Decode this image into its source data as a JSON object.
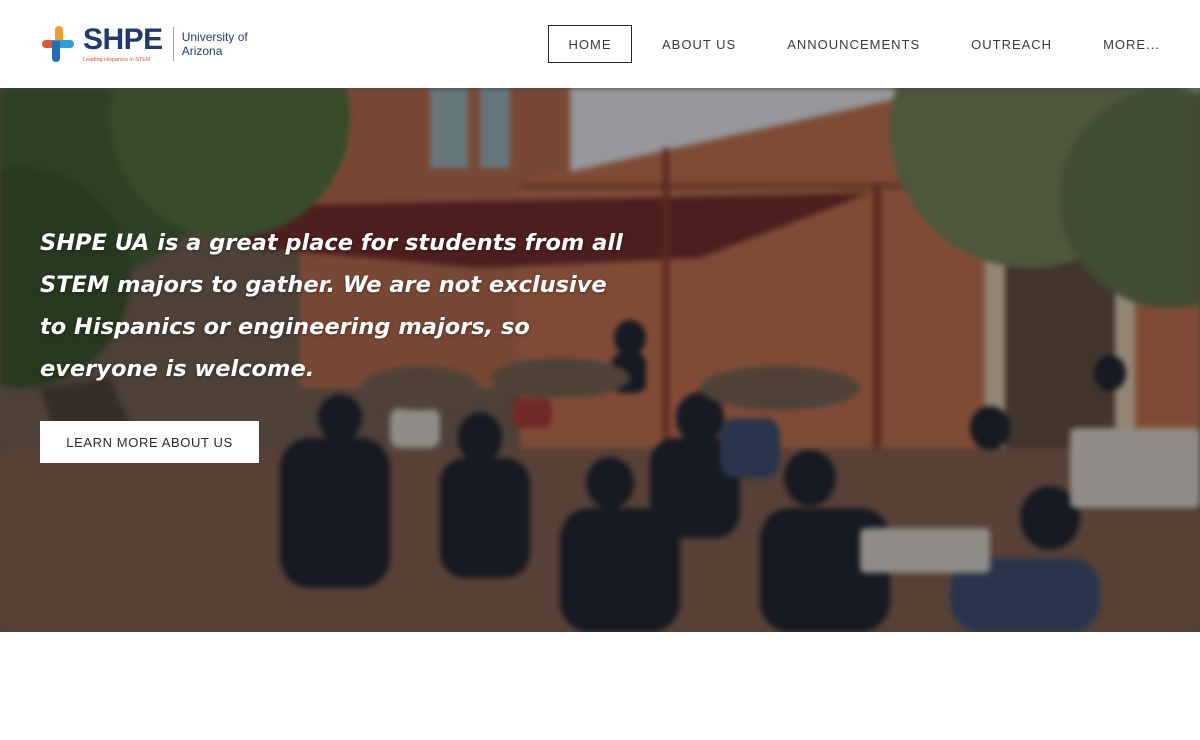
{
  "logo": {
    "wordmark": "SHPE",
    "tagline": "Leading Hispanics in STEM",
    "university": "University of\nArizona"
  },
  "nav": {
    "items": [
      {
        "label": "HOME",
        "active": true
      },
      {
        "label": "ABOUT US",
        "active": false
      },
      {
        "label": "ANNOUNCEMENTS",
        "active": false
      },
      {
        "label": "OUTREACH",
        "active": false
      },
      {
        "label": "MORE...",
        "active": false
      }
    ]
  },
  "hero": {
    "headline": "SHPE UA is a great place for students from all STEM majors to gather. We are not exclusive to Hispanics or engineering majors, so everyone is welcome.",
    "cta_label": "LEARN MORE ABOUT US",
    "background_description_icon": "photo-crowd-courtyard"
  },
  "colors": {
    "brand_navy": "#1f3a73",
    "brand_orange": "#e8542f",
    "brand_blue": "#2f9fd6"
  }
}
